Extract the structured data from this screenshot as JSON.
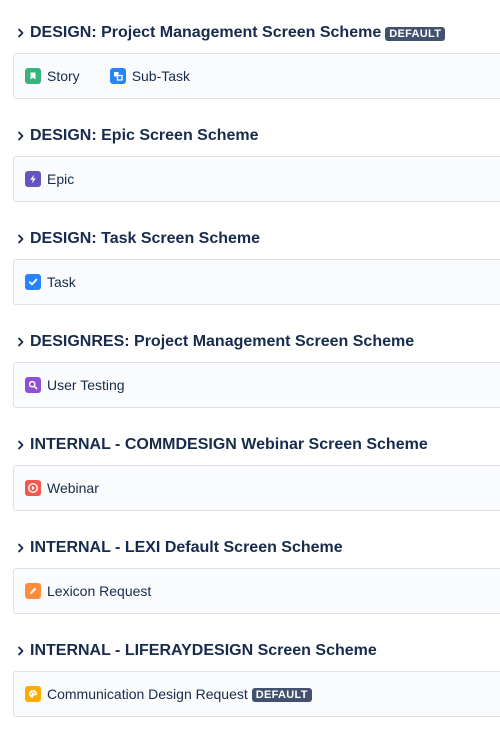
{
  "schemes": [
    {
      "title": "DESIGN: Project Management Screen Scheme",
      "default_label": "DEFAULT",
      "issue_types": [
        {
          "label": "Story",
          "icon": "story-icon",
          "color": "#36b37e"
        },
        {
          "label": "Sub-Task",
          "icon": "subtask-icon",
          "color": "#0065ff"
        }
      ]
    },
    {
      "title": "DESIGN: Epic Screen Scheme",
      "issue_types": [
        {
          "label": "Epic",
          "icon": "epic-icon",
          "color": "#6554c0"
        }
      ]
    },
    {
      "title": "DESIGN: Task Screen Scheme",
      "issue_types": [
        {
          "label": "Task",
          "icon": "task-icon",
          "color": "#2684ff"
        }
      ]
    },
    {
      "title": "DESIGNRES: Project Management Screen Scheme",
      "issue_types": [
        {
          "label": "User Testing",
          "icon": "user-testing-icon",
          "color": "#8f4fd6"
        }
      ]
    },
    {
      "title": "INTERNAL - COMMDESIGN Webinar Screen Scheme",
      "issue_types": [
        {
          "label": "Webinar",
          "icon": "webinar-icon",
          "color": "#f5564a"
        }
      ]
    },
    {
      "title": "INTERNAL - LEXI Default Screen Scheme",
      "issue_types": [
        {
          "label": "Lexicon Request",
          "icon": "lexicon-request-icon",
          "color": "#ff8b3d"
        }
      ]
    },
    {
      "title": "INTERNAL - LIFERAYDESIGN Screen Scheme",
      "issue_types": [
        {
          "label": "Communication Design Request",
          "icon": "communication-design-request-icon",
          "color": "#ffab00",
          "default_label": "DEFAULT"
        }
      ]
    }
  ]
}
